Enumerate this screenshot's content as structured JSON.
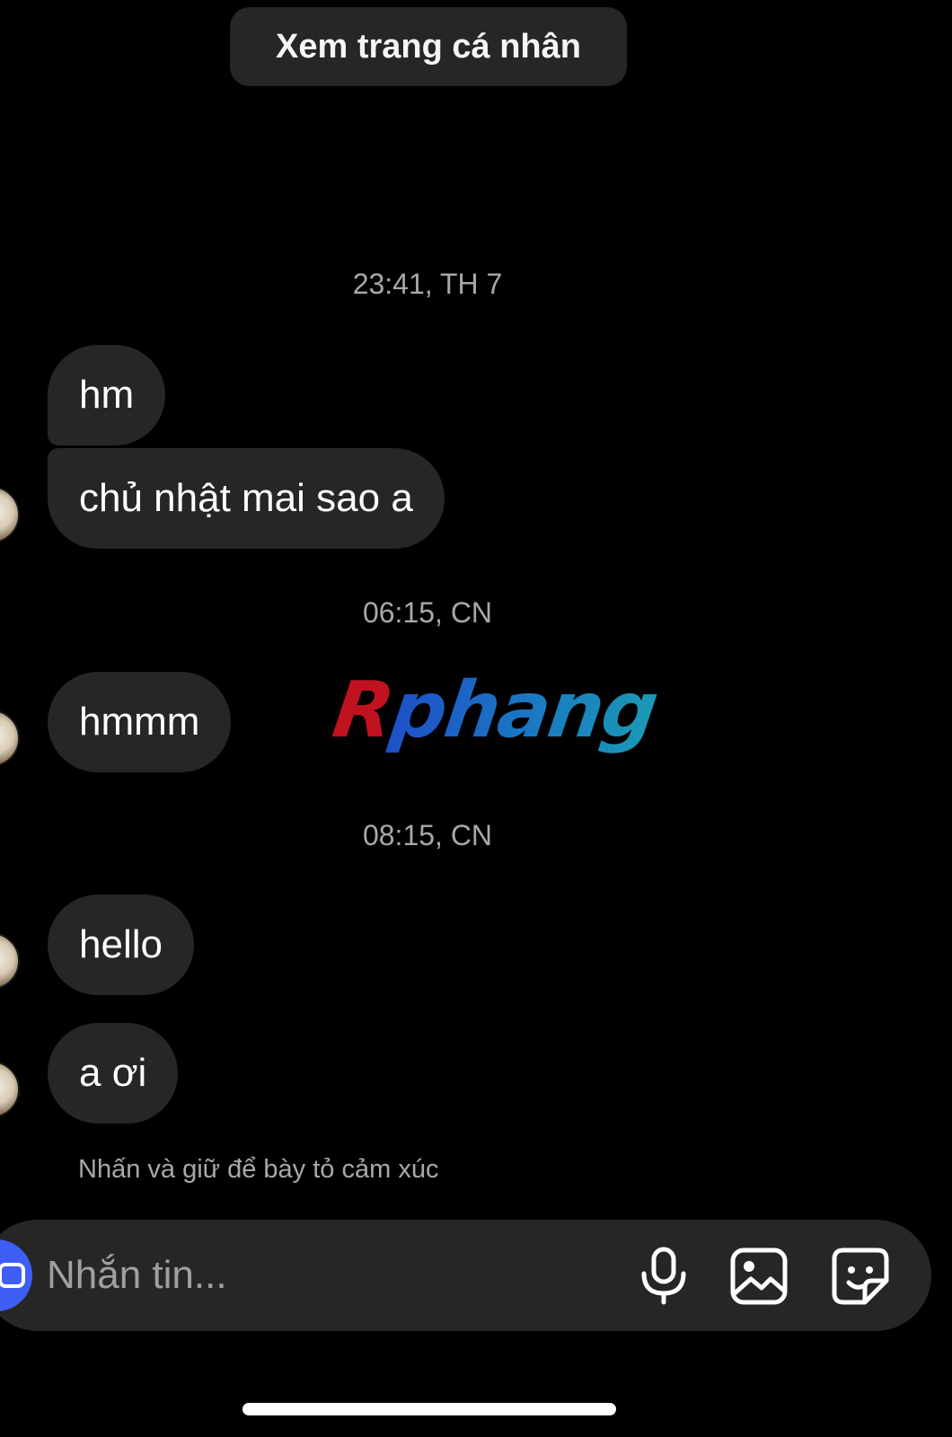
{
  "header": {
    "profile_button_label": "Xem trang cá nhân"
  },
  "conversation": {
    "groups": [
      {
        "timestamp": "23:41, TH 7",
        "messages": [
          "hm",
          "chủ nhật mai sao a"
        ]
      },
      {
        "timestamp": "06:15, CN",
        "messages": [
          "hmmm"
        ]
      },
      {
        "timestamp": "08:15, CN",
        "messages": [
          "hello",
          "a ơi"
        ]
      }
    ],
    "reaction_hint": "Nhấn và giữ để bày tỏ cảm xúc"
  },
  "watermark": {
    "first_letter": "R",
    "rest": "phang"
  },
  "composer": {
    "placeholder": "Nhắn tin...",
    "icons": [
      "camera-icon",
      "microphone-icon",
      "image-icon",
      "sticker-icon"
    ]
  },
  "colors": {
    "background": "#000000",
    "bubble": "#262626",
    "secondary_text": "#a8a8a8",
    "camera_button": "#3f5ef5"
  }
}
